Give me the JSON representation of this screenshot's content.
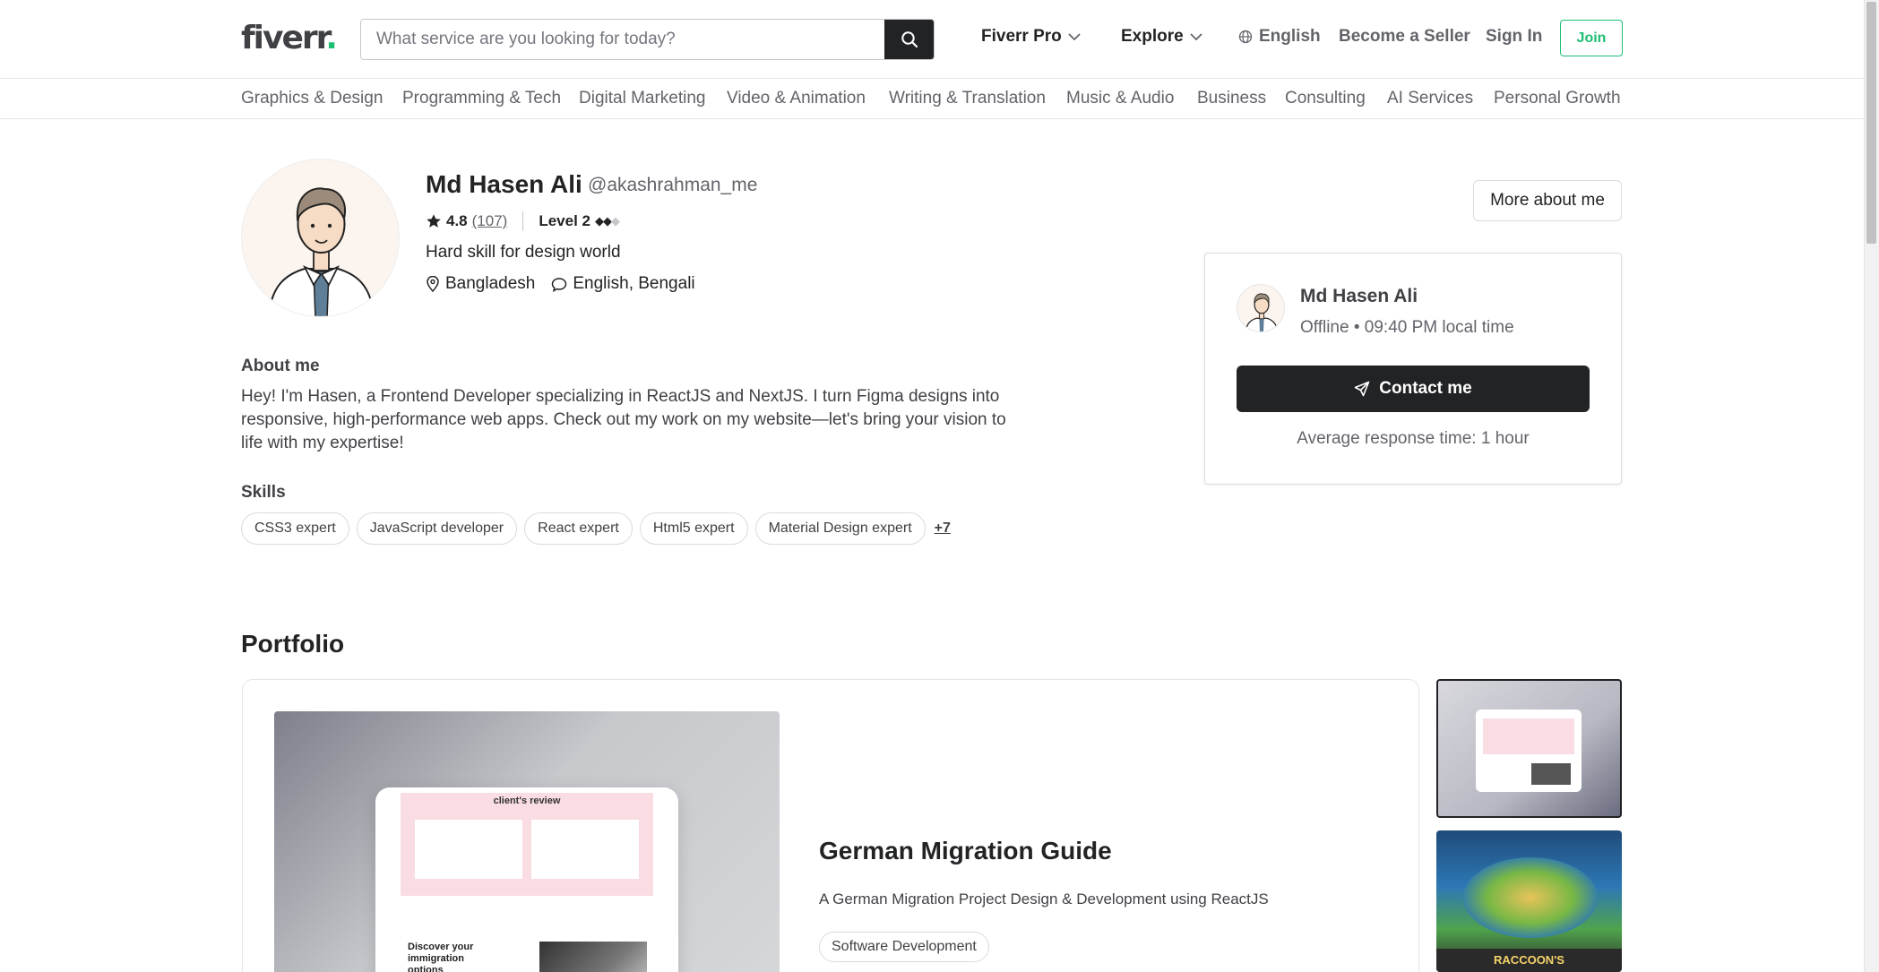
{
  "header": {
    "logo_text": "fiverr",
    "logo_dot": ".",
    "search_placeholder": "What service are you looking for today?",
    "nav": {
      "pro": "Fiverr Pro",
      "explore": "Explore",
      "language": "English",
      "become_seller": "Become a Seller",
      "sign_in": "Sign In",
      "join": "Join"
    }
  },
  "categories": [
    "Graphics & Design",
    "Programming & Tech",
    "Digital Marketing",
    "Video & Animation",
    "Writing & Translation",
    "Music & Audio",
    "Business",
    "Consulting",
    "AI Services",
    "Personal Growth"
  ],
  "profile": {
    "name": "Md Hasen Ali",
    "handle": "@akashrahman_me",
    "rating": "4.8",
    "reviews": "(107)",
    "level": "Level 2",
    "level_diamonds_filled": 2,
    "level_diamonds_total": 3,
    "tagline": "Hard skill for design world",
    "location": "Bangladesh",
    "languages": "English, Bengali",
    "about_heading": "About me",
    "about_text": "Hey! I'm Hasen, a Frontend Developer specializing in ReactJS and NextJS. I turn Figma designs into responsive, high-performance web apps. Check out my work on my website—let's bring your vision to life with my expertise!",
    "skills_heading": "Skills",
    "skills": [
      "CSS3 expert",
      "JavaScript developer",
      "React expert",
      "Html5 expert",
      "Material Design expert"
    ],
    "more_skills": "+7",
    "more_about": "More about me"
  },
  "contact_card": {
    "name": "Md Hasen Ali",
    "status": "Offline • 09:40 PM local time",
    "button": "Contact me",
    "response": "Average response time: 1 hour"
  },
  "portfolio": {
    "heading": "Portfolio",
    "project_title": "German Migration Guide",
    "project_desc": "A German Migration Project Design & Development using ReactJS",
    "project_tag": "Software Development",
    "preview_heading": "client's review",
    "preview_subtext": "Discover your immigration options",
    "thumb2_text": "RACCOON'S"
  },
  "colors": {
    "brand_green": "#1dbf73",
    "dark": "#222325",
    "muted": "#62646a"
  }
}
